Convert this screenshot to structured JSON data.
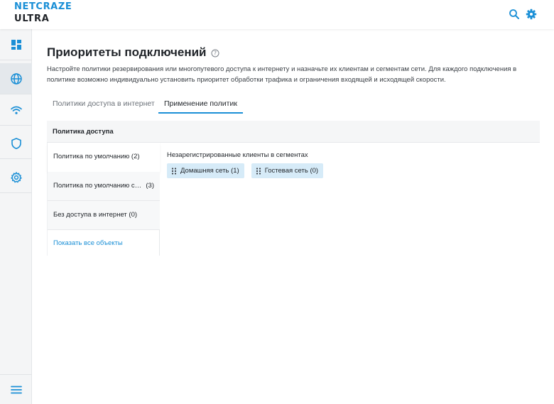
{
  "header": {
    "brand": "NETCRAZE",
    "model": "ULTRA",
    "icons": [
      "search-icon",
      "gear-icon"
    ]
  },
  "sidebar": {
    "items": [
      {
        "icon": "dashboard-icon",
        "active": false
      },
      {
        "icon": "globe-icon",
        "active": true
      },
      {
        "icon": "wifi-icon",
        "active": false
      },
      {
        "icon": "shield-icon",
        "active": false
      },
      {
        "icon": "gear-icon",
        "active": false
      }
    ],
    "bottom_icon": "menu-icon"
  },
  "page": {
    "title": "Приоритеты подключений",
    "description": "Настройте политики резервирования или многопутевого доступа к интернету и назначьте их клиентам и сегментам сети. Для каждого подключения в политике возможно индивидуально установить приоритет обработки трафика и ограничения входящей и исходящей скорости."
  },
  "tabs": [
    {
      "label": "Политики доступа в интернет",
      "active": false
    },
    {
      "label": "Применение политик",
      "active": true
    }
  ],
  "policies": {
    "header": "Политика доступа",
    "items": [
      {
        "label": "Политика по умолчанию (2)",
        "selected": true
      },
      {
        "label": "Политика по умолчанию сег...",
        "count": "(3)",
        "selected": false
      },
      {
        "label": "Без доступа в интернет (0)",
        "selected": false
      }
    ],
    "show_all": "Показать все объекты"
  },
  "content": {
    "group_label": "Незарегистрированные клиенты в сегментах",
    "chips": [
      {
        "label": "Домашняя сеть (1)"
      },
      {
        "label": "Гостевая сеть (0)"
      }
    ]
  },
  "colors": {
    "accent": "#1a8fd6",
    "chip_bg": "#d6ebf8",
    "sidebar_bg": "#f4f5f6"
  }
}
